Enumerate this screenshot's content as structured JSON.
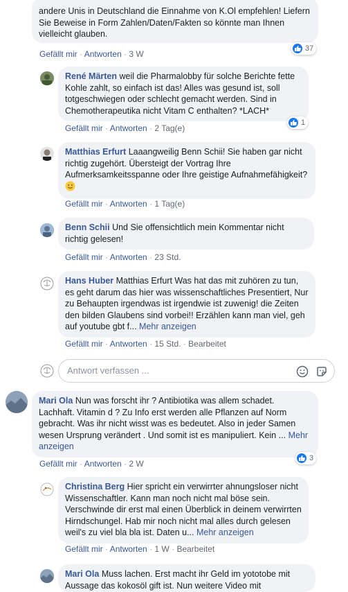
{
  "comments": [
    {
      "author": "",
      "text": "andere Unis in Deutschland die Einnahme von K.Ol empfehlen! Liefern Sie Beweise in Form Zahlen/Daten/Fakten so könnte man Ihnen vielleicht glauben.",
      "like": "Gefällt mir",
      "reply": "Antworten",
      "time": "3 W",
      "reactions": "37"
    },
    {
      "author": "René Märten",
      "text": "weil die Pharmalobby für solche Berichte fette Kohle zahlt, so einfach ist das! Alles was gesund ist, soll totgeschwiegen oder schlecht gemacht werden. Sind in Chemotherapeutika nicht Vitam C enthalten? *LACH*",
      "like": "Gefällt mir",
      "reply": "Antworten",
      "time": "2 Tag(e)",
      "reactions": "1"
    },
    {
      "author": "Matthias Erfurt",
      "text": "Laaangweilig Benn Schii! Sie haben gar nicht richtig zugehört. Übersteigt der Vortrag Ihre Aufmerksamkeitsspanne oder Ihre geistige Aufnahmefähigkeit?",
      "like": "Gefällt mir",
      "reply": "Antworten",
      "time": "1 Tag(e)"
    },
    {
      "author": "Benn Schii",
      "text": "Und Sie offensichtlich mein Kommentar nicht richtig gelesen!",
      "like": "Gefällt mir",
      "reply": "Antworten",
      "time": "23 Std."
    },
    {
      "author": "Hans Huber",
      "text": "Matthias Erfurt Was hat das mit zuhören zu tun, es geht darum das hier was wissenschaftliches Presentiert, Nur zu Behaupten irgendwas ist irgendwie ist zuwenig! die Zeiten den bilden Glaubens sind vorbei!! Erzählen kann man viel, geh auf youtube gbt f...",
      "more": "Mehr anzeigen",
      "like": "Gefällt mir",
      "reply": "Antworten",
      "time": "15 Std.",
      "edited": "Bearbeitet"
    },
    {
      "author": "Mari Ola",
      "text": "Nun was forscht ihr ? Antibiotika was allem schadet. Lachhaft. Vitamin d ? Zu Info erst werden alle Pflanzen auf Norm gebracht. Was ihr nicht wisst was es bedeutet. Also in jeder Samen wesen Ursprung verändert . Und somit ist es manipuliert. Kein ...",
      "more": "Mehr anzeigen",
      "like": "Gefällt mir",
      "reply": "Antworten",
      "time": "2 W",
      "reactions": "3"
    },
    {
      "author": "Christina Berg",
      "text": "Hier spricht ein verwirrter ahnungsloser nicht Wissenschaftler. Kann man noch nicht mal böse sein. Verschwinde dir erst mal einen Überblick in deinem verwirrten Hirndschungel. Hab mir noch nicht mal alles durch gelesen weil's zu viel bla bla ist. Daten u...",
      "more": "Mehr anzeigen",
      "like": "Gefällt mir",
      "reply": "Antworten",
      "time": "1 W",
      "edited": "Bearbeitet"
    },
    {
      "author": "Mari Ola",
      "text": "Muss lachen. Erst macht ihr Geld im yototobe mit Aussage das kokosöl gift ist. Nun weitere Video mit"
    }
  ],
  "reply_box": {
    "placeholder": "Antwort verfassen ..."
  },
  "separator": "·",
  "colors": {
    "link": "#385898",
    "bubble": "#f0f2f5",
    "like_blue": "#1877f2"
  },
  "icons": [
    "like-icon",
    "emoji-icon",
    "sticker-icon",
    "avatar-placeholder-icon"
  ]
}
